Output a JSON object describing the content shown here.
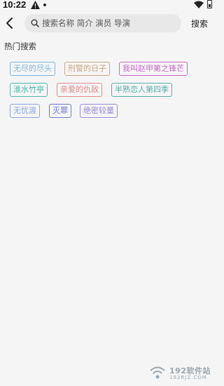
{
  "statusbar": {
    "time": "10:22"
  },
  "search": {
    "placeholder": "搜索名称 简介 演员 导演",
    "button_label": "搜索"
  },
  "hot_search": {
    "title": "热门搜索",
    "tags": [
      {
        "label": "无尽的尽头",
        "color": "#7fb7d9"
      },
      {
        "label": "刑警的日子",
        "color": "#c9a888"
      },
      {
        "label": "我叫赵甲第之锋芒",
        "color": "#c76ac9"
      },
      {
        "label": "淮水竹亭",
        "color": "#4fb7a8"
      },
      {
        "label": "亲爱的仇敌",
        "color": "#e08a8a"
      },
      {
        "label": "半熟恋人第四季",
        "color": "#5aaea8"
      },
      {
        "label": "无忧渡",
        "color": "#8aa7e0"
      },
      {
        "label": "灭罪",
        "color": "#6b7bd0"
      },
      {
        "label": "绝密较量",
        "color": "#9b8ad8"
      }
    ]
  },
  "watermark": {
    "text": "192软件站",
    "sub": "192RJZ.COM"
  }
}
